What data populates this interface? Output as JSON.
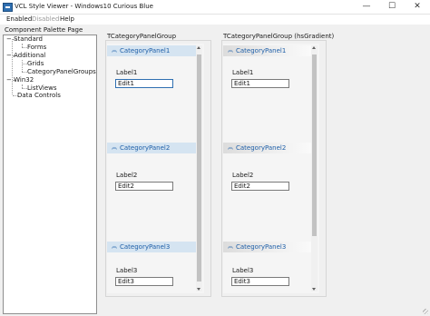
{
  "window": {
    "title": "VCL Style Viewer - Windows10 Curious Blue",
    "minimize_glyph": "—",
    "maximize_glyph": "☐",
    "close_glyph": "✕"
  },
  "menu": {
    "enabled": "Enabled",
    "disabled": "Disabled",
    "help": "Help"
  },
  "palette": {
    "title": "Component Palette Page",
    "tree": [
      {
        "label": "Standard",
        "toggle": "−"
      },
      {
        "label": "Forms"
      },
      {
        "label": "Additional",
        "toggle": "−"
      },
      {
        "label": "Grids"
      },
      {
        "label": "CategoryPanelGroups"
      },
      {
        "label": "Win32",
        "toggle": "−"
      },
      {
        "label": "ListViews"
      },
      {
        "label": "Data Controls"
      }
    ]
  },
  "groups": {
    "plain": {
      "caption": "TCategoryPanelGroup",
      "panels": [
        {
          "header": "CategoryPanel1",
          "label": "Label1",
          "edit": "Edit1"
        },
        {
          "header": "CategoryPanel2",
          "label": "Label2",
          "edit": "Edit2"
        },
        {
          "header": "CategoryPanel3",
          "label": "Label3",
          "edit": "Edit3"
        }
      ]
    },
    "gradient": {
      "caption": "TCategoryPanelGroup (hsGradient)",
      "panels": [
        {
          "header": "CategoryPanel1",
          "label": "Label1",
          "edit": "Edit1"
        },
        {
          "header": "CategoryPanel2",
          "label": "Label2",
          "edit": "Edit2"
        },
        {
          "header": "CategoryPanel3",
          "label": "Label3",
          "edit": "Edit3"
        }
      ]
    },
    "chevron_glyph": "︽"
  },
  "colors": {
    "accent": "#2f6fb1",
    "header_text": "#1e5fa8",
    "header_plain_bg": "#d5e4f1"
  }
}
